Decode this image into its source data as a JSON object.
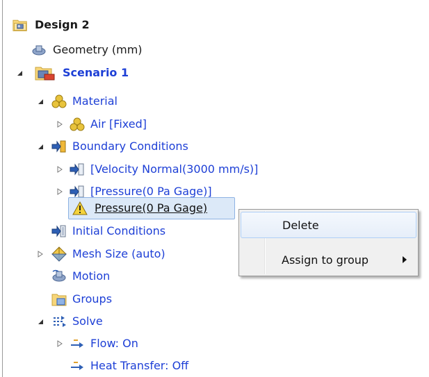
{
  "tree": {
    "design": "Design 2",
    "geometry": "Geometry (mm)",
    "scenario": "Scenario 1",
    "material": "Material",
    "air": "Air [Fixed]",
    "boundary_conditions": "Boundary Conditions",
    "velocity_normal": "[Velocity Normal(3000 mm/s)]",
    "pressure_group": "[Pressure(0 Pa Gage)]",
    "pressure_selected": "Pressure(0 Pa Gage)",
    "initial_conditions": "Initial Conditions",
    "mesh_size": "Mesh Size (auto)",
    "motion": "Motion",
    "groups": "Groups",
    "solve": "Solve",
    "flow": "Flow: On",
    "heat_transfer": "Heat Transfer: Off"
  },
  "context_menu": {
    "delete": "Delete",
    "assign_to_group": "Assign to group"
  },
  "colors": {
    "link_blue": "#1d3fd6",
    "selection_bg": "#dce9f8",
    "selection_border": "#8db2e3",
    "menu_bg": "#f0f0f0"
  }
}
